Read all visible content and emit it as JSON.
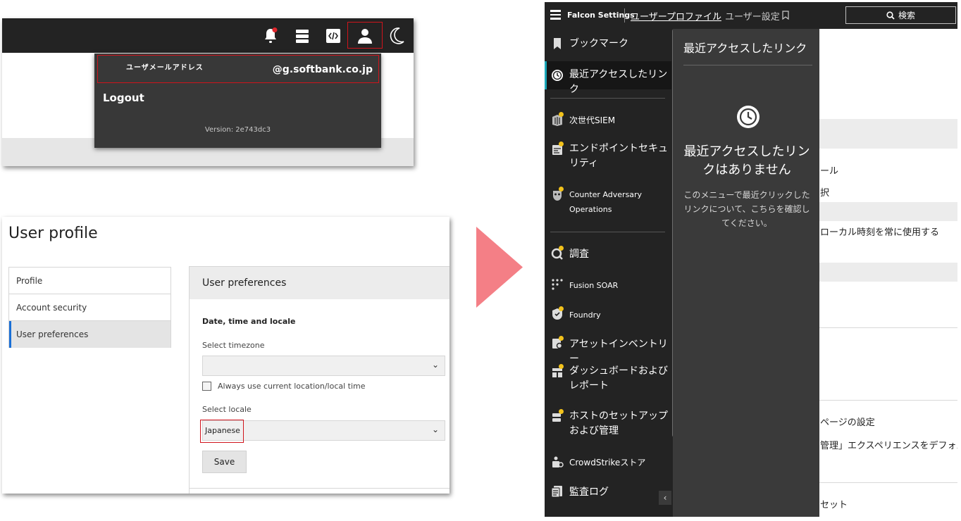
{
  "panel1": {
    "email_label": "ユーザメールアドレス",
    "email_domain": "@g.softbank.co.jp",
    "logout": "Logout",
    "version": "Version: 2e743dc3",
    "icons": [
      "bell-icon",
      "stack-icon",
      "code-icon",
      "user-icon",
      "moon-icon"
    ]
  },
  "panel2": {
    "title": "User profile",
    "nav": [
      "Profile",
      "Account security",
      "User preferences"
    ],
    "selected_nav": "User preferences",
    "section_title": "User preferences",
    "group_title": "Date, time and locale",
    "timezone_label": "Select timezone",
    "timezone_value": "",
    "checkbox_label": "Always use current location/local time",
    "checkbox_checked": false,
    "locale_label": "Select locale",
    "locale_value": "Japanese",
    "save": "Save"
  },
  "panel3": {
    "brand": "Falcon Settings",
    "breadcrumb_link": "ユーザープロファイル",
    "breadcrumb_sep": "›",
    "breadcrumb_current": "ユーザー設定",
    "search": "検索",
    "sidebar": [
      "ブックマーク",
      "最近アクセスしたリンク",
      "次世代SIEM",
      "エンドポイントセキュリティ",
      "Counter Adversary Operations",
      "調査",
      "Fusion SOAR",
      "Foundry",
      "アセットインベントリー",
      "ダッシュボードおよびレポート",
      "ホストのセットアップおよび管理",
      "CrowdStrikeストア",
      "監査ログ"
    ],
    "active_item": "最近アクセスしたリンク",
    "collapse": "‹",
    "recent_title": "最近アクセスしたリンク",
    "recent_empty": "最近アクセスしたリンクはありません",
    "recent_desc": "このメニューで最近クリックしたリンクについて、こちらを確認してください。",
    "background_texts": [
      "ール",
      "択",
      "ローカル時刻を常に使用する",
      "ページの設定",
      "管理」エクスペリエンスをデフォル",
      "セット"
    ],
    "accent_color": "#1aa7b8",
    "badge_color": "#f2c21b"
  },
  "arrow_color": "#f47f86"
}
